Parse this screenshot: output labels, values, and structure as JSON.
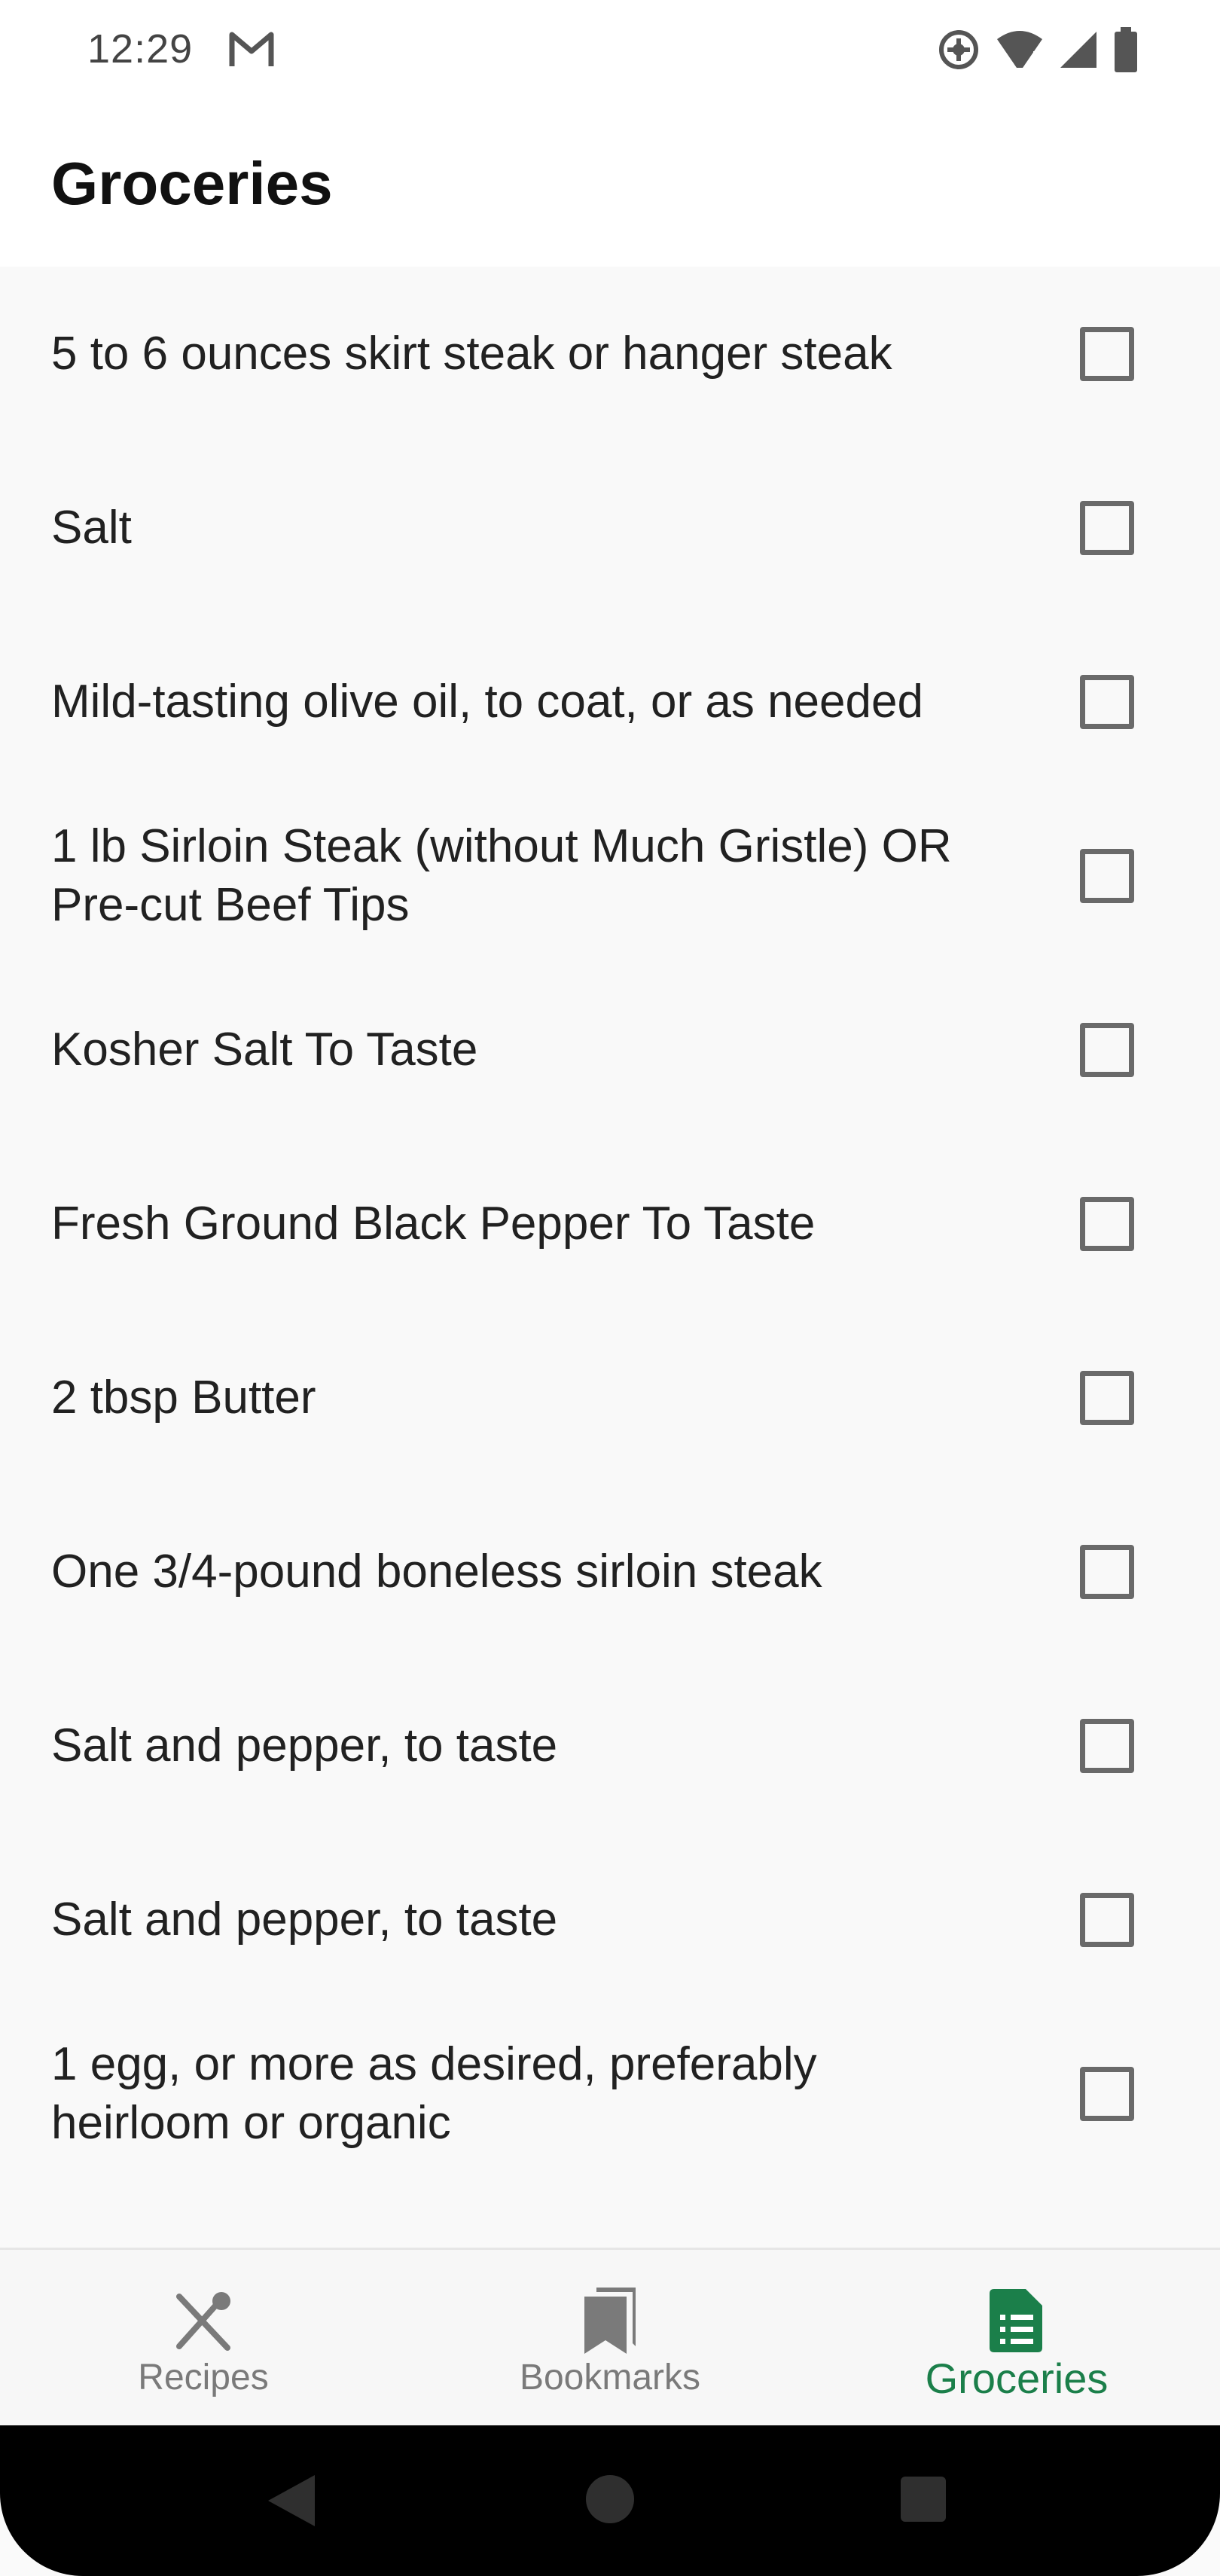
{
  "status_bar": {
    "time": "12:29",
    "icons": [
      "gmail-icon",
      "sync-icon",
      "wifi-icon",
      "signal-icon",
      "battery-icon"
    ]
  },
  "app_bar": {
    "title": "Groceries"
  },
  "groceries": [
    {
      "text": "5 to 6 ounces skirt steak or hanger steak",
      "checked": false
    },
    {
      "text": "Salt",
      "checked": false
    },
    {
      "text": "Mild-tasting olive oil, to coat, or as needed",
      "checked": false
    },
    {
      "text": "1 lb Sirloin Steak (without Much Gristle) OR Pre-cut Beef Tips",
      "checked": false
    },
    {
      "text": "Kosher Salt To Taste",
      "checked": false
    },
    {
      "text": "Fresh Ground Black Pepper To Taste",
      "checked": false
    },
    {
      "text": "2 tbsp Butter",
      "checked": false
    },
    {
      "text": "One 3/4-pound boneless sirloin steak",
      "checked": false
    },
    {
      "text": "Salt and pepper, to taste",
      "checked": false
    },
    {
      "text": "Salt and pepper, to taste",
      "checked": false
    },
    {
      "text": "1 egg, or more as desired, preferably heirloom or organic",
      "checked": false
    }
  ],
  "bottom_nav": {
    "items": [
      {
        "label": "Recipes",
        "icon": "fork-knife-icon",
        "active": false
      },
      {
        "label": "Bookmarks",
        "icon": "bookmarks-icon",
        "active": false
      },
      {
        "label": "Groceries",
        "icon": "list-doc-icon",
        "active": true
      }
    ],
    "active_color": "#1b7f4a",
    "inactive_color": "#7a7a7a"
  },
  "system_nav": {
    "buttons": [
      "back-icon",
      "home-icon",
      "recents-icon"
    ]
  }
}
